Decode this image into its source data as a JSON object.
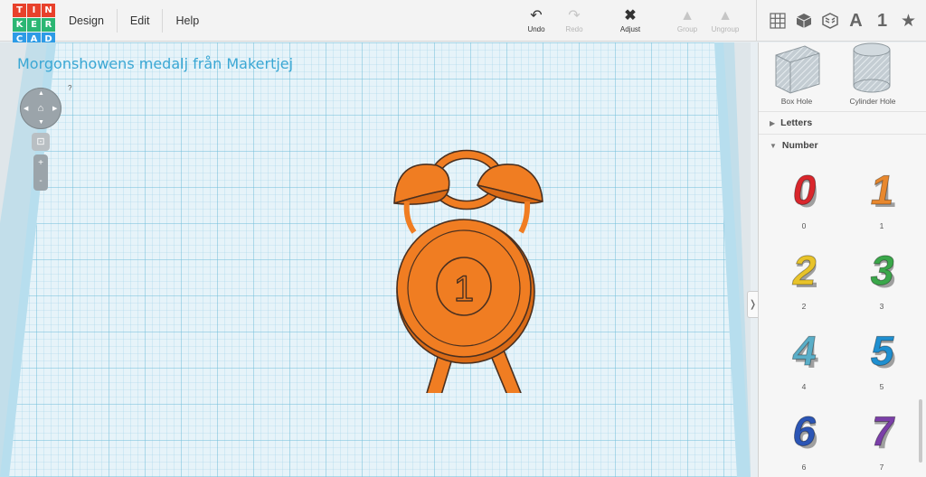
{
  "app": {
    "logo_letters": [
      "T",
      "I",
      "N",
      "K",
      "E",
      "R",
      "C",
      "A",
      "D"
    ],
    "logo_colors": [
      "#e8412b",
      "#e8412b",
      "#e8412b",
      "#2bb673",
      "#2bb673",
      "#2bb673",
      "#2d9be6",
      "#2d9be6",
      "#2d9be6"
    ]
  },
  "menu": {
    "design": "Design",
    "edit": "Edit",
    "help": "Help"
  },
  "toolbar": {
    "undo": "Undo",
    "redo": "Redo",
    "adjust": "Adjust",
    "group": "Group",
    "ungroup": "Ungroup"
  },
  "view_icons": [
    "workplane-icon",
    "box-view-icon",
    "pattern-icon",
    "letter-a-icon",
    "number-1-icon",
    "star-icon"
  ],
  "view_glyphs": {
    "letter": "A",
    "number": "1",
    "star": "★"
  },
  "workspace": {
    "title": "Morgonshowens medalj från Makertjej",
    "help_mark": "?"
  },
  "model": {
    "medal_number": "1",
    "color": "#f07d22"
  },
  "sidebar": {
    "holes": [
      {
        "label": "Box Hole"
      },
      {
        "label": "Cylinder Hole"
      }
    ],
    "sections": {
      "letters": "Letters",
      "number": "Number"
    },
    "numbers": [
      {
        "label": "0",
        "color": "#d9262c"
      },
      {
        "label": "1",
        "color": "#e8882e"
      },
      {
        "label": "2",
        "color": "#e8c32a"
      },
      {
        "label": "3",
        "color": "#3aa74a"
      },
      {
        "label": "4",
        "color": "#5aaec8"
      },
      {
        "label": "5",
        "color": "#1f8fd0"
      },
      {
        "label": "6",
        "color": "#2b55b5"
      },
      {
        "label": "7",
        "color": "#7b3fa8"
      }
    ]
  }
}
